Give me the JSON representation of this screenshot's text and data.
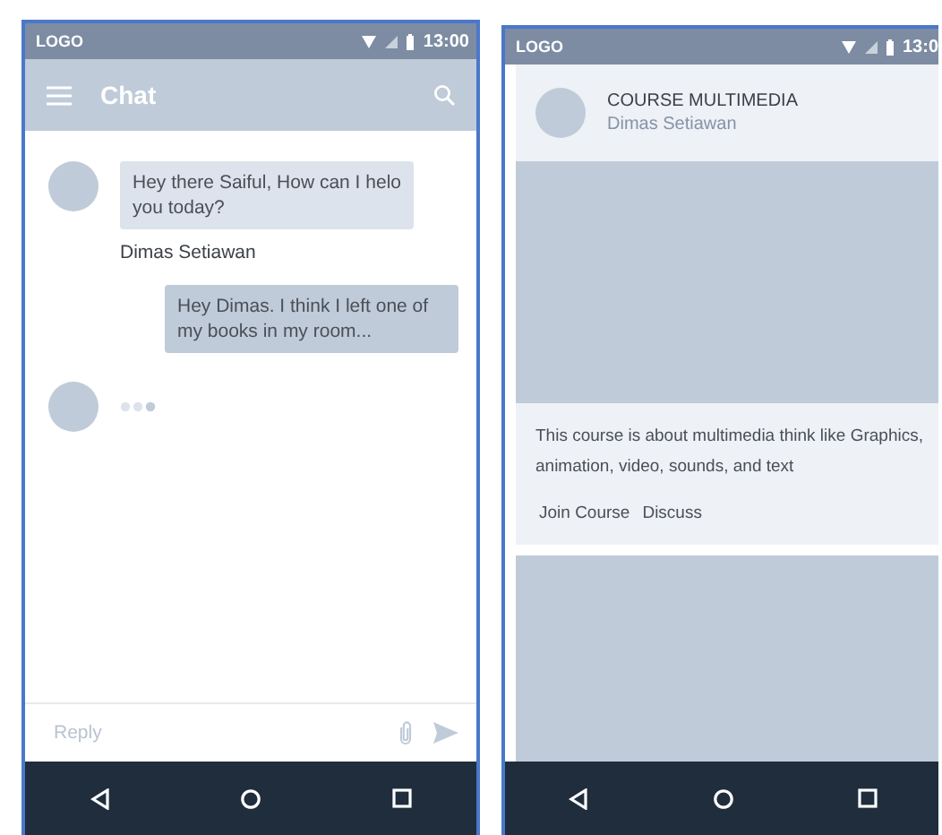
{
  "phones": [
    {
      "kind": "chat",
      "status_bar": {
        "logo": "LOGO",
        "time": "13:00"
      },
      "app_bar": {
        "title": "Chat"
      },
      "messages": [
        {
          "kind": "incoming",
          "text": "Hey there Saiful, How can I helo you today?",
          "sender": "Dimas Setiawan"
        },
        {
          "kind": "outgoing",
          "text": "Hey Dimas. I think I left one of my books in my room..."
        },
        {
          "kind": "typing"
        }
      ],
      "reply": {
        "placeholder": "Reply"
      }
    },
    {
      "kind": "course",
      "status_bar": {
        "logo": "LOGO",
        "time": "13:0"
      },
      "cards": [
        {
          "kind": "course",
          "title": "COURSE MULTIMEDIA",
          "author": "Dimas Setiawan",
          "description": "This course is about multimedia think like Graphics, animation, video, sounds, and text",
          "actions": [
            "Join Course",
            "Discuss"
          ]
        },
        {
          "kind": "picture"
        }
      ]
    }
  ]
}
